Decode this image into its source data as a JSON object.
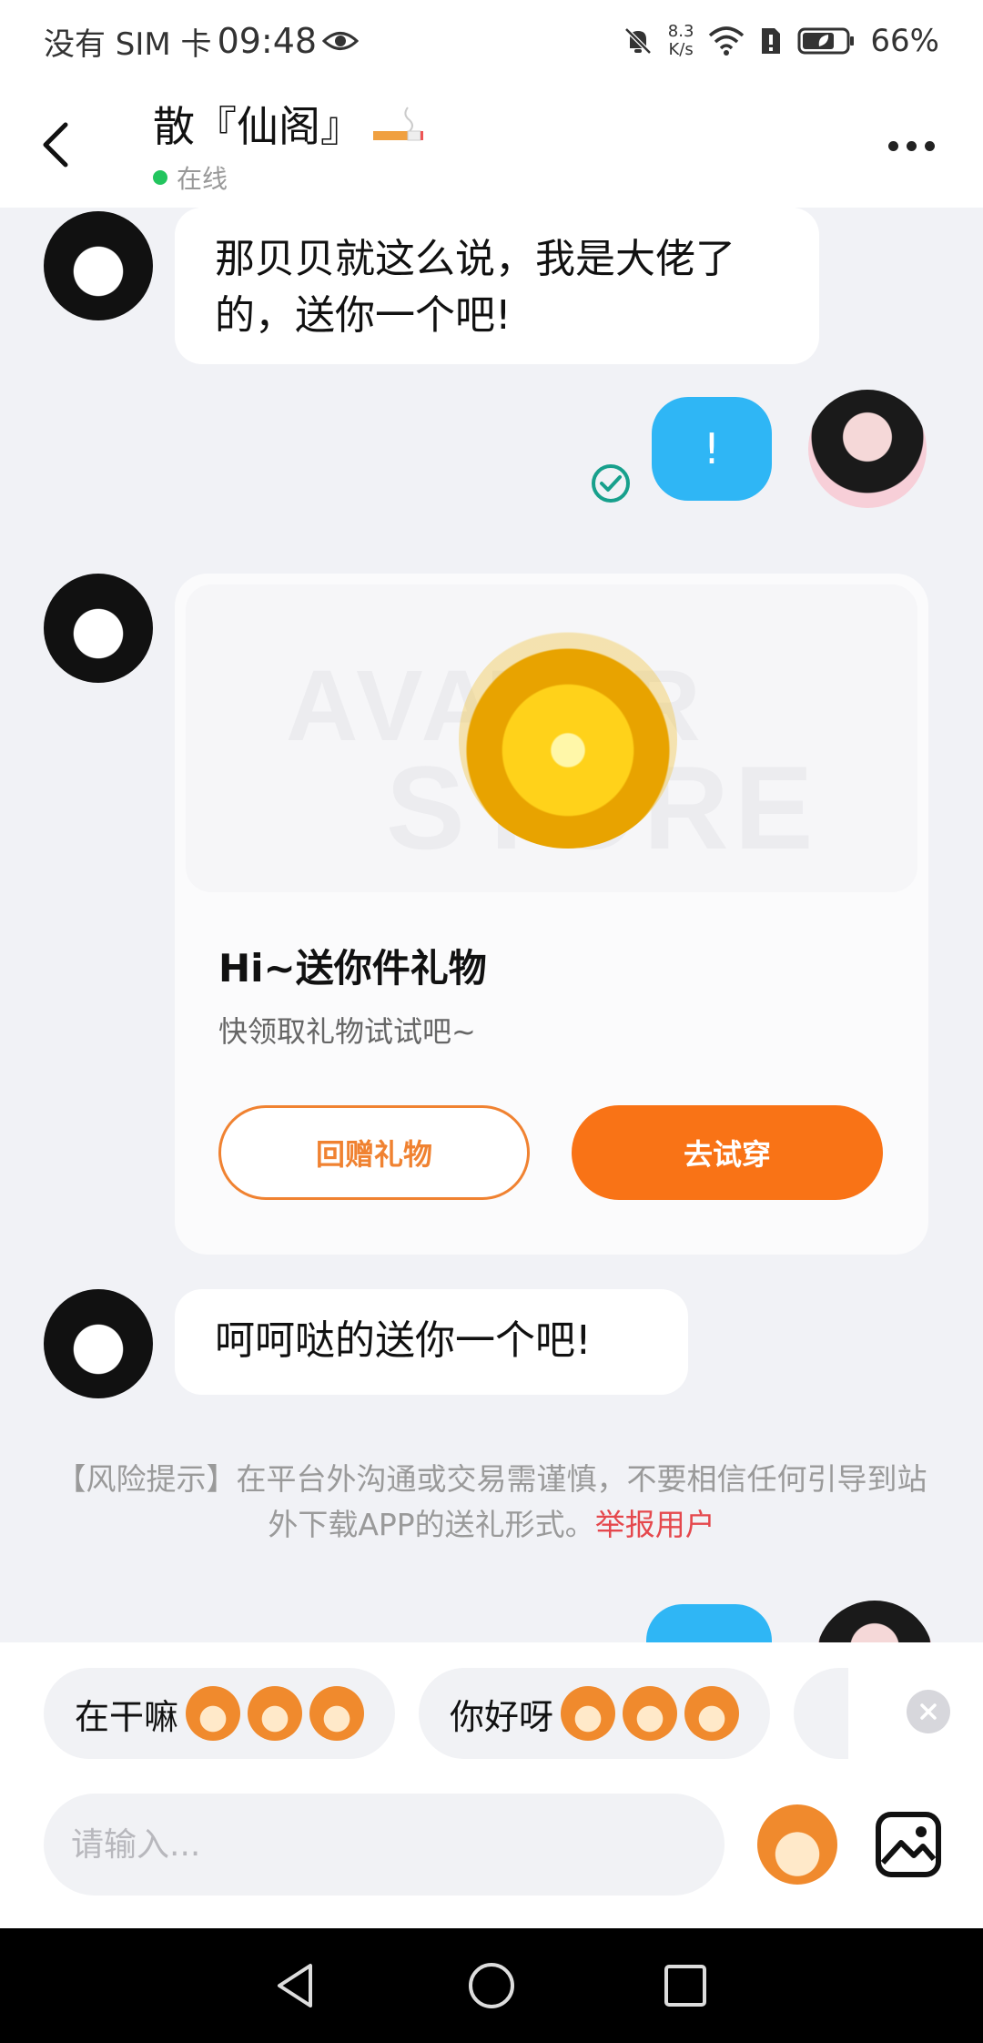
{
  "status_bar": {
    "carrier": "没有 SIM 卡",
    "time": "09:48",
    "net_speed_value": "8.3",
    "net_speed_unit": "K/s",
    "battery": "66%"
  },
  "header": {
    "title": "散『仙阁』",
    "status": "在线"
  },
  "messages": [
    {
      "from": "other",
      "text": "那贝贝就这么说，我是大佬了的，送你一个吧!"
    },
    {
      "from": "self",
      "text": "!"
    },
    {
      "from": "other",
      "type": "gift_card",
      "watermark_line1": "AVATAR",
      "watermark_line2": "STORE",
      "title": "Hi~送你件礼物",
      "subtitle": "快领取礼物试试吧~",
      "btn_return": "回赠礼物",
      "btn_try": "去试穿"
    },
    {
      "from": "other",
      "text": "呵呵哒的送你一个吧!"
    }
  ],
  "risk_notice": {
    "text": "【风险提示】在平台外沟通或交易需谨慎，不要相信任何引导到站外下载APP的送礼形式。",
    "link": "举报用户"
  },
  "quick_replies": [
    "在干嘛",
    "你好呀"
  ],
  "input": {
    "placeholder": "请输入..."
  },
  "colors": {
    "accent_orange": "#f97316",
    "self_bubble": "#2fb6f5",
    "online": "#22c55e",
    "report_link": "#e5484d"
  }
}
